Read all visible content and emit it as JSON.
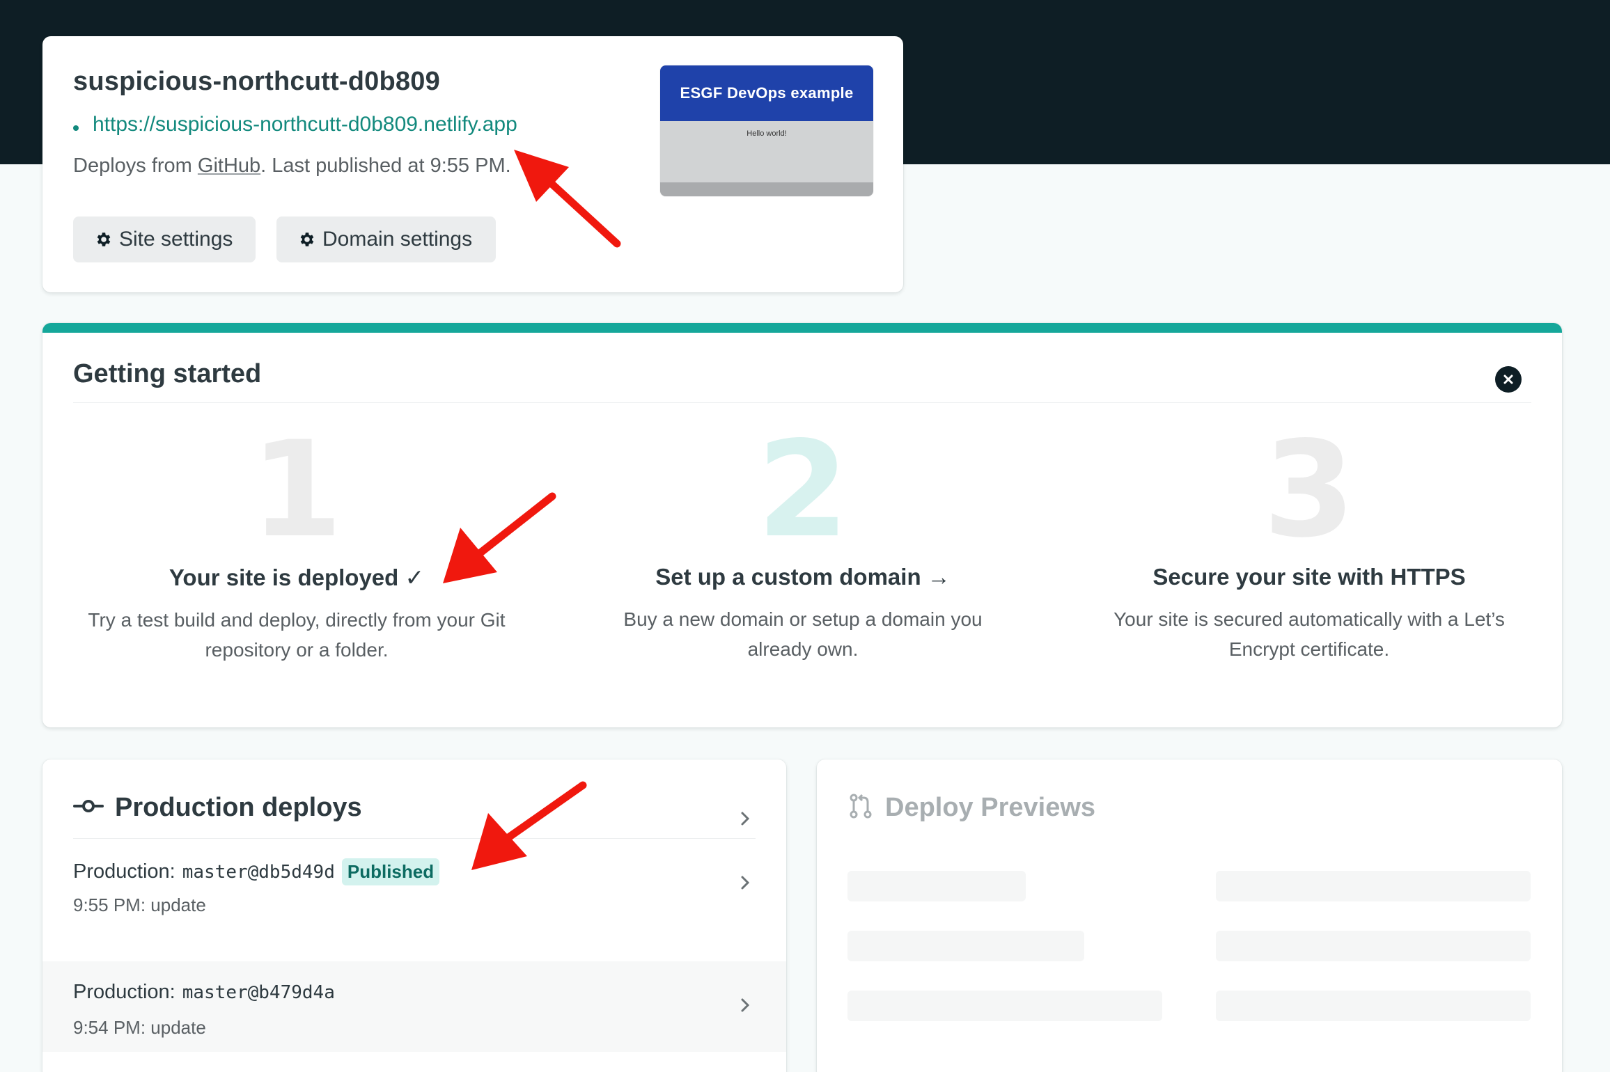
{
  "site": {
    "name": "suspicious-northcutt-d0b809",
    "url": "https://suspicious-northcutt-d0b809.netlify.app",
    "deploy_prefix": "Deploys from ",
    "deploy_source": "GitHub",
    "deploy_suffix": ". Last published at 9:55 PM.",
    "buttons": {
      "site_settings": "Site settings",
      "domain_settings": "Domain settings"
    },
    "preview": {
      "header": "ESGF DevOps example",
      "body": "Hello world!"
    }
  },
  "getting_started": {
    "title": "Getting started",
    "steps": [
      {
        "number": "1",
        "title": "Your site is deployed ✓",
        "description": "Try a test build and deploy, directly from your Git repository or a folder."
      },
      {
        "number": "2",
        "title": "Set up a custom domain →",
        "description": "Buy a new domain or setup a domain you already own."
      },
      {
        "number": "3",
        "title": "Secure your site with HTTPS",
        "description": "Your site is secured automatically with a Let’s Encrypt certificate."
      }
    ]
  },
  "production_deploys": {
    "title": "Production deploys",
    "rows": [
      {
        "label": "Production:",
        "ref": "master@db5d49d",
        "badge": "Published",
        "time": "9:55 PM: update"
      },
      {
        "label": "Production:",
        "ref": "master@b479d4a",
        "badge": "",
        "time": "9:54 PM: update"
      }
    ]
  },
  "deploy_previews": {
    "title": "Deploy Previews"
  },
  "colors": {
    "topbar": "#0e1e25",
    "accent_teal": "#15a79a",
    "link": "#12897d",
    "badge_bg": "#d3f2ee",
    "annotation_arrow": "#f0180e"
  },
  "icons": {
    "settings": "gear-icon",
    "close": "close-icon",
    "production": "commit-icon",
    "previews": "pull-request-icon",
    "row_chevron": "chevron-right-icon"
  }
}
